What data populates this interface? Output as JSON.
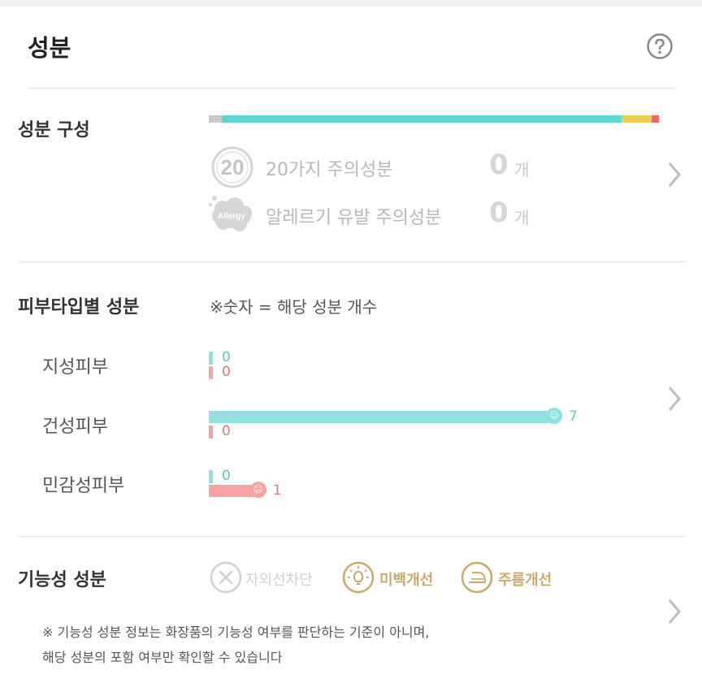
{
  "header": {
    "title": "성분"
  },
  "composition": {
    "title": "성분 구성",
    "bar_colors": [
      "#c8c8c8",
      "#5ed6d6",
      "#f3cd4b",
      "#f06a6a"
    ],
    "bar_fractions": [
      0.03,
      0.896,
      0.068,
      0.016
    ],
    "items": [
      {
        "badge": "20",
        "label": "20가지 주의성분",
        "count": "0",
        "unit": "개"
      },
      {
        "badge": "Allergy",
        "label": "알레르기 유발 주의성분",
        "count": "0",
        "unit": "개"
      }
    ]
  },
  "skin_type": {
    "title": "피부타입별 성분",
    "note": "※숫자 = 해당 성분 개수",
    "max": 7,
    "rows": [
      {
        "label": "지성피부",
        "good": 0,
        "bad": 0,
        "good_text": "0",
        "bad_text": "0"
      },
      {
        "label": "건성피부",
        "good": 7,
        "bad": 0,
        "good_text": "7",
        "bad_text": "0"
      },
      {
        "label": "민감성피부",
        "good": 0,
        "bad": 1,
        "good_text": "0",
        "bad_text": "1"
      }
    ],
    "colors": {
      "good": "#8fe0de",
      "good_text": "#5cc7c4",
      "bad": "#f6a3a3",
      "bad_text": "#e07878"
    }
  },
  "functional": {
    "title": "기능성 성분",
    "items": [
      {
        "label": "자외선차단",
        "icon": "x-circle-icon",
        "active": false
      },
      {
        "label": "미백개선",
        "icon": "lightbulb-icon",
        "active": true
      },
      {
        "label": "주름개선",
        "icon": "iron-icon",
        "active": true
      }
    ],
    "note_line1": "※ 기능성 성분 정보는 화장품의 기능성 여부를 판단하는 기준이 아니며,",
    "note_line2": "해당 성분의 포함 여부만 확인할 수 있습니다",
    "colors": {
      "active": "#c9a86a",
      "inactive": "#cfcfcf"
    }
  }
}
